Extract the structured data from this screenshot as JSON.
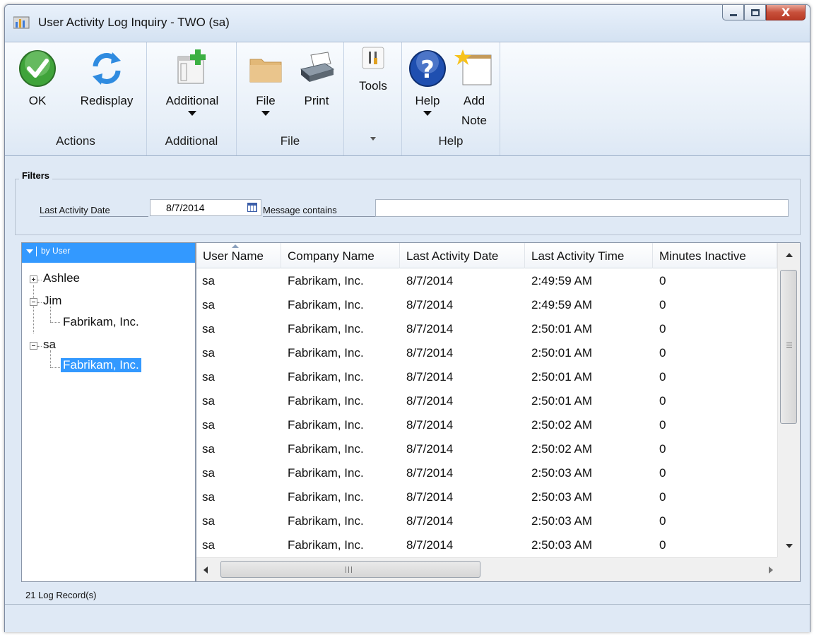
{
  "window": {
    "title": "User Activity Log Inquiry  -  TWO (sa)",
    "close_symbol": "X"
  },
  "ribbon": {
    "actions": {
      "ok": "OK",
      "redisplay": "Redisplay",
      "group_label": "Actions"
    },
    "additional": {
      "additional": "Additional",
      "group_label": "Additional"
    },
    "file": {
      "file": "File",
      "print": "Print",
      "group_label": "File"
    },
    "tools": {
      "tools": "Tools"
    },
    "help": {
      "help": "Help",
      "add_note_line1": "Add",
      "add_note_line2": "Note",
      "group_label": "Help"
    }
  },
  "filters": {
    "legend": "Filters",
    "last_activity_date_label": "Last Activity Date",
    "last_activity_date_value": "8/7/2014",
    "message_contains_label": "Message contains",
    "message_contains_value": ""
  },
  "tree": {
    "header": "by User",
    "nodes": {
      "ashlee": "Ashlee",
      "jim": "Jim",
      "jim_company": "Fabrikam, Inc.",
      "sa": "sa",
      "sa_company": "Fabrikam, Inc."
    }
  },
  "grid": {
    "columns": [
      "User Name",
      "Company Name",
      "Last Activity Date",
      "Last Activity Time",
      "Minutes Inactive"
    ],
    "rows": [
      [
        "sa",
        "Fabrikam, Inc.",
        "8/7/2014",
        "2:49:59 AM",
        "0"
      ],
      [
        "sa",
        "Fabrikam, Inc.",
        "8/7/2014",
        "2:49:59 AM",
        "0"
      ],
      [
        "sa",
        "Fabrikam, Inc.",
        "8/7/2014",
        "2:50:01 AM",
        "0"
      ],
      [
        "sa",
        "Fabrikam, Inc.",
        "8/7/2014",
        "2:50:01 AM",
        "0"
      ],
      [
        "sa",
        "Fabrikam, Inc.",
        "8/7/2014",
        "2:50:01 AM",
        "0"
      ],
      [
        "sa",
        "Fabrikam, Inc.",
        "8/7/2014",
        "2:50:01 AM",
        "0"
      ],
      [
        "sa",
        "Fabrikam, Inc.",
        "8/7/2014",
        "2:50:02 AM",
        "0"
      ],
      [
        "sa",
        "Fabrikam, Inc.",
        "8/7/2014",
        "2:50:02 AM",
        "0"
      ],
      [
        "sa",
        "Fabrikam, Inc.",
        "8/7/2014",
        "2:50:03 AM",
        "0"
      ],
      [
        "sa",
        "Fabrikam, Inc.",
        "8/7/2014",
        "2:50:03 AM",
        "0"
      ],
      [
        "sa",
        "Fabrikam, Inc.",
        "8/7/2014",
        "2:50:03 AM",
        "0"
      ],
      [
        "sa",
        "Fabrikam, Inc.",
        "8/7/2014",
        "2:50:03 AM",
        "0"
      ]
    ],
    "hscroll_grip": "III"
  },
  "footer": {
    "record_count": "21 Log Record(s)"
  },
  "colors": {
    "selection": "#3399ff",
    "window_bg": "#dfe9f5",
    "ok_green": "#3fa33a",
    "help_blue": "#1f4fb0"
  }
}
